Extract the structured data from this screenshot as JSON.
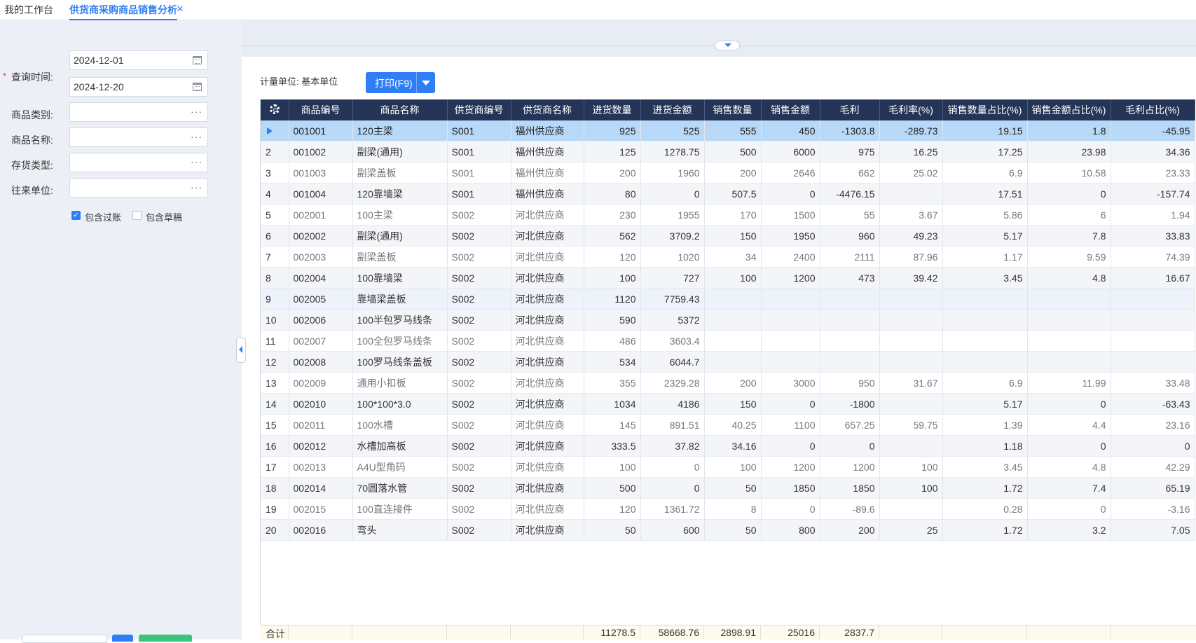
{
  "tabs": {
    "home": "我的工作台",
    "active": "供货商采购商品销售分析"
  },
  "filters": {
    "query_time_label": "查询时间:",
    "date_from": "2024-12-01",
    "date_to": "2024-12-20",
    "category_label": "商品类别:",
    "name_label": "商品名称:",
    "stock_type_label": "存货类型:",
    "partner_label": "往来单位:",
    "ellipsis": "···",
    "include_posted_label": "包含过账",
    "include_posted_checked": true,
    "include_draft_label": "包含草稿",
    "include_draft_checked": false
  },
  "toolbar": {
    "unit_label": "计量单位:  基本单位",
    "print_label": "打印(F9)"
  },
  "colors": {
    "accent": "#2f7ef5",
    "header_bg": "#243558",
    "selected_row": "#b8d8f7"
  },
  "columns": [
    "商品编号",
    "商品名称",
    "供货商编号",
    "供货商名称",
    "进货数量",
    "进货金额",
    "销售数量",
    "销售金额",
    "毛利",
    "毛利率(%)",
    "销售数量占比(%)",
    "销售金额占比(%)",
    "毛利占比(%)"
  ],
  "rows": [
    [
      "1",
      "001001",
      "120主梁",
      "S001",
      "福州供应商",
      "925",
      "525",
      "555",
      "450",
      "-1303.8",
      "-289.73",
      "19.15",
      "1.8",
      "-45.95"
    ],
    [
      "2",
      "001002",
      "副梁(通用)",
      "S001",
      "福州供应商",
      "125",
      "1278.75",
      "500",
      "6000",
      "975",
      "16.25",
      "17.25",
      "23.98",
      "34.36"
    ],
    [
      "3",
      "001003",
      "副梁盖板",
      "S001",
      "福州供应商",
      "200",
      "1960",
      "200",
      "2646",
      "662",
      "25.02",
      "6.9",
      "10.58",
      "23.33"
    ],
    [
      "4",
      "001004",
      "120靠墙梁",
      "S001",
      "福州供应商",
      "80",
      "0",
      "507.5",
      "0",
      "-4476.15",
      "",
      "17.51",
      "0",
      "-157.74"
    ],
    [
      "5",
      "002001",
      "100主梁",
      "S002",
      "河北供应商",
      "230",
      "1955",
      "170",
      "1500",
      "55",
      "3.67",
      "5.86",
      "6",
      "1.94"
    ],
    [
      "6",
      "002002",
      "副梁(通用)",
      "S002",
      "河北供应商",
      "562",
      "3709.2",
      "150",
      "1950",
      "960",
      "49.23",
      "5.17",
      "7.8",
      "33.83"
    ],
    [
      "7",
      "002003",
      "副梁盖板",
      "S002",
      "河北供应商",
      "120",
      "1020",
      "34",
      "2400",
      "2111",
      "87.96",
      "1.17",
      "9.59",
      "74.39"
    ],
    [
      "8",
      "002004",
      "100靠墙梁",
      "S002",
      "河北供应商",
      "100",
      "727",
      "100",
      "1200",
      "473",
      "39.42",
      "3.45",
      "4.8",
      "16.67"
    ],
    [
      "9",
      "002005",
      "靠墙梁盖板",
      "S002",
      "河北供应商",
      "1120",
      "7759.43",
      "",
      "",
      "",
      "",
      "",
      "",
      ""
    ],
    [
      "10",
      "002006",
      "100半包罗马线条",
      "S002",
      "河北供应商",
      "590",
      "5372",
      "",
      "",
      "",
      "",
      "",
      "",
      ""
    ],
    [
      "11",
      "002007",
      "100全包罗马线条",
      "S002",
      "河北供应商",
      "486",
      "3603.4",
      "",
      "",
      "",
      "",
      "",
      "",
      ""
    ],
    [
      "12",
      "002008",
      "100罗马线条盖板",
      "S002",
      "河北供应商",
      "534",
      "6044.7",
      "",
      "",
      "",
      "",
      "",
      "",
      ""
    ],
    [
      "13",
      "002009",
      "通用小扣板",
      "S002",
      "河北供应商",
      "355",
      "2329.28",
      "200",
      "3000",
      "950",
      "31.67",
      "6.9",
      "11.99",
      "33.48"
    ],
    [
      "14",
      "002010",
      "100*100*3.0",
      "S002",
      "河北供应商",
      "1034",
      "4186",
      "150",
      "0",
      "-1800",
      "",
      "5.17",
      "0",
      "-63.43"
    ],
    [
      "15",
      "002011",
      "100水槽",
      "S002",
      "河北供应商",
      "145",
      "891.51",
      "40.25",
      "1100",
      "657.25",
      "59.75",
      "1.39",
      "4.4",
      "23.16"
    ],
    [
      "16",
      "002012",
      "水槽加高板",
      "S002",
      "河北供应商",
      "333.5",
      "37.82",
      "34.16",
      "0",
      "0",
      "",
      "1.18",
      "0",
      "0"
    ],
    [
      "17",
      "002013",
      "A4U型角码",
      "S002",
      "河北供应商",
      "100",
      "0",
      "100",
      "1200",
      "1200",
      "100",
      "3.45",
      "4.8",
      "42.29"
    ],
    [
      "18",
      "002014",
      "70圆落水管",
      "S002",
      "河北供应商",
      "500",
      "0",
      "50",
      "1850",
      "1850",
      "100",
      "1.72",
      "7.4",
      "65.19"
    ],
    [
      "19",
      "002015",
      "100直连接件",
      "S002",
      "河北供应商",
      "120",
      "1361.72",
      "8",
      "0",
      "-89.6",
      "",
      "0.28",
      "0",
      "-3.16"
    ],
    [
      "20",
      "002016",
      "弯头",
      "S002",
      "河北供应商",
      "50",
      "600",
      "50",
      "800",
      "200",
      "25",
      "1.72",
      "3.2",
      "7.05"
    ]
  ],
  "summary": {
    "label": "合计",
    "purchase_qty": "11278.5",
    "purchase_amount": "58668.76",
    "sales_qty": "2898.91",
    "sales_amount": "25016",
    "gross_profit": "2837.7"
  }
}
